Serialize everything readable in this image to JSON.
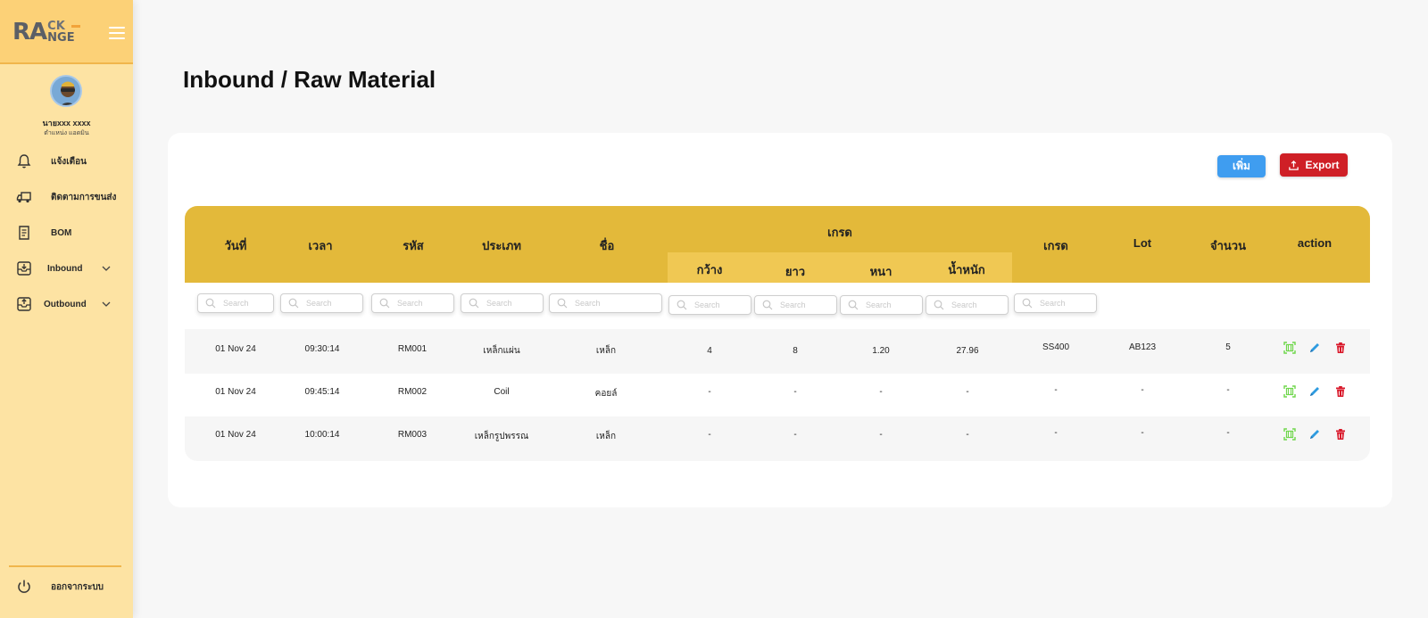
{
  "sidebar": {
    "logo": {
      "ra": "RA",
      "ck": "CK",
      "nge": "NGE"
    },
    "user": {
      "name": "นายxxx xxxx",
      "role": "ตำแหน่ง แอดมิน"
    },
    "items": [
      {
        "label": "แจ้งเตือน",
        "icon": "bell-icon"
      },
      {
        "label": "ติดตามการขนส่ง",
        "icon": "truck-icon"
      },
      {
        "label": "BOM",
        "icon": "document-list-icon"
      },
      {
        "label": "Inbound",
        "icon": "inbox-download-icon"
      },
      {
        "label": "Outbound",
        "icon": "inbox-upload-icon"
      }
    ],
    "logout": "ออกจากระบบ"
  },
  "page": {
    "title": "Inbound / Raw Material"
  },
  "toolbar": {
    "add_label": "เพิ่ม",
    "export_label": "Export"
  },
  "colors": {
    "sidebar": "#fde3a3",
    "header": "#e3b93a",
    "subheader": "#f0c853",
    "add": "#3f9df0",
    "export": "#cf1f26",
    "scan": "#6ed64a",
    "edit": "#2e9be0",
    "delete": "#d9182a"
  },
  "table": {
    "headers": {
      "date": "วันที่",
      "time": "เวลา",
      "code": "รหัส",
      "type": "ประเภท",
      "name": "ชื่อ",
      "group": "เกรด",
      "width": "กว้าง",
      "length": "ยาว",
      "thickness": "หนา",
      "weight": "น้ำหนัก",
      "grade": "เกรด",
      "lot": "Lot",
      "qty": "จำนวน",
      "action": "action"
    },
    "search_placeholder": "Search",
    "rows": [
      {
        "date": "01 Nov 24",
        "time": "09:30:14",
        "code": "RM001",
        "type": "เหล็กแผ่น",
        "name": "เหล็ก",
        "width": "4",
        "length": "8",
        "thickness": "1.20",
        "weight": "27.96",
        "grade": "SS400",
        "lot": "AB123",
        "qty": "5"
      },
      {
        "date": "01 Nov 24",
        "time": "09:45:14",
        "code": "RM002",
        "type": "Coil",
        "name": "คอยล์",
        "width": "-",
        "length": "-",
        "thickness": "-",
        "weight": "-",
        "grade": "-",
        "lot": "-",
        "qty": "-"
      },
      {
        "date": "01 Nov 24",
        "time": "10:00:14",
        "code": "RM003",
        "type": "เหล็กรูปพรรณ",
        "name": "เหล็ก",
        "width": "-",
        "length": "-",
        "thickness": "-",
        "weight": "-",
        "grade": "-",
        "lot": "-",
        "qty": "-"
      }
    ]
  }
}
